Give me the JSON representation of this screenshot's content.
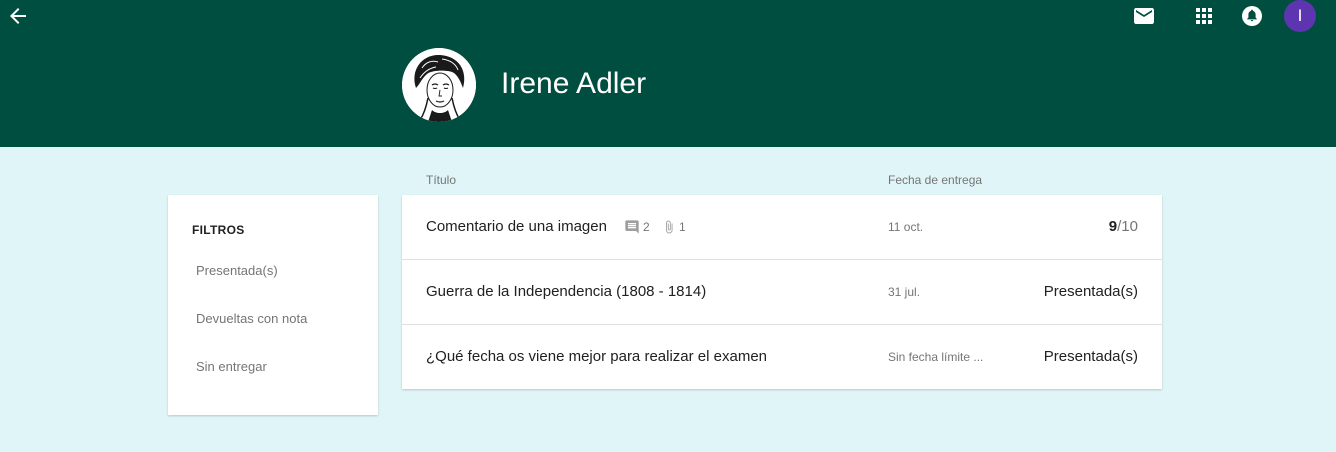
{
  "colors": {
    "header": "#004e40",
    "background": "#dff5f7",
    "avatar": "#5e35b1"
  },
  "header": {
    "back_icon": "arrow-back-icon",
    "icons": [
      "mail-icon",
      "apps-grid-icon",
      "notifications-icon"
    ],
    "user_initial": "I"
  },
  "profile": {
    "name": "Irene Adler"
  },
  "filters": {
    "title": "FILTROS",
    "items": [
      {
        "label": "Presentada(s)"
      },
      {
        "label": "Devueltas con nota"
      },
      {
        "label": "Sin entregar"
      }
    ]
  },
  "table": {
    "headers": {
      "title": "Título",
      "due_date": "Fecha de entrega"
    },
    "rows": [
      {
        "title": "Comentario de una imagen",
        "comments": "2",
        "attachments": "1",
        "date": "11 oct.",
        "grade": "9",
        "grade_max": "/10"
      },
      {
        "title": "Guerra de la Independencia (1808 - 1814)",
        "date": "31 jul.",
        "status": "Presentada(s)"
      },
      {
        "title": "¿Qué fecha os viene mejor para realizar el examen",
        "date": "Sin fecha límite ...",
        "status": "Presentada(s)"
      }
    ]
  }
}
